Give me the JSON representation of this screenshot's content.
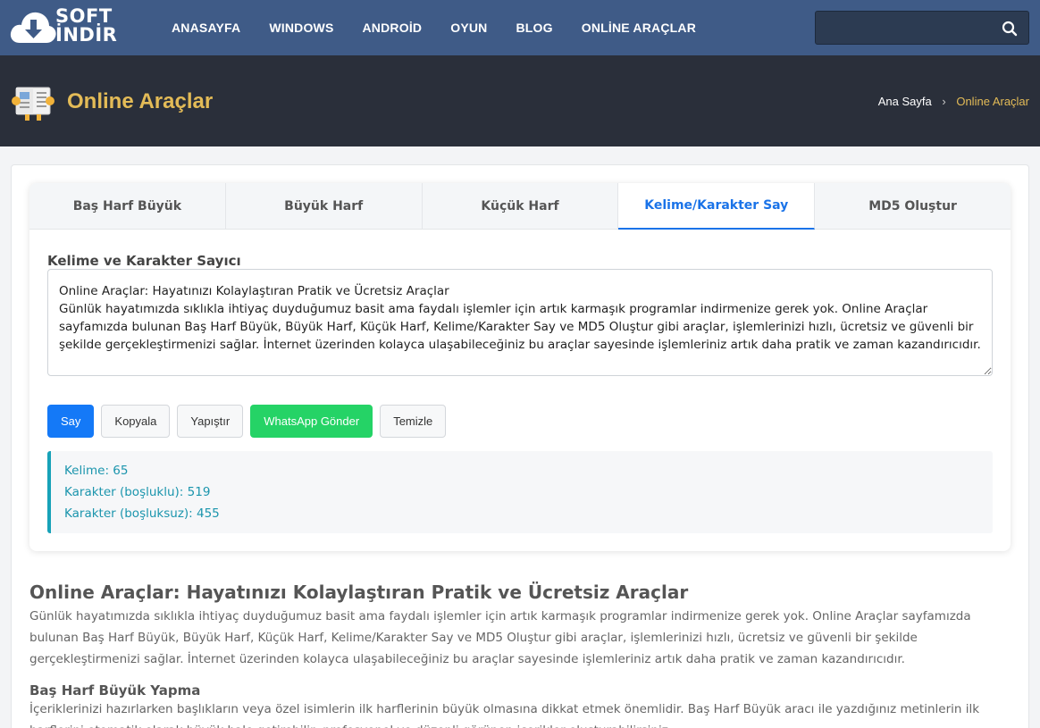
{
  "header": {
    "logo_line1": "SOFT",
    "logo_line2": "İNDİR",
    "nav": [
      "ANASAYFA",
      "WINDOWS",
      "ANDROİD",
      "OYUN",
      "BLOG",
      "ONLİNE ARAÇLAR"
    ],
    "search_placeholder": ""
  },
  "page": {
    "title": "Online Araçlar",
    "breadcrumb": {
      "home": "Ana Sayfa",
      "separator": "›",
      "current": "Online Araçlar"
    }
  },
  "tool": {
    "tabs": [
      "Baş Harf Büyük",
      "Büyük Harf",
      "Küçük Harf",
      "Kelime/Karakter Say",
      "MD5 Oluştur"
    ],
    "active_tab": "Kelime/Karakter Say",
    "label": "Kelime ve Karakter Sayıcı",
    "textarea_value": "Online Araçlar: Hayatınızı Kolaylaştıran Pratik ve Ücretsiz Araçlar\nGünlük hayatımızda sıklıkla ihtiyaç duyduğumuz basit ama faydalı işlemler için artık karmaşık programlar indirmenize gerek yok. Online Araçlar sayfamızda bulunan Baş Harf Büyük, Büyük Harf, Küçük Harf, Kelime/Karakter Say ve MD5 Oluştur gibi araçlar, işlemlerinizi hızlı, ücretsiz ve güvenli bir şekilde gerçekleştirmenizi sağlar. İnternet üzerinden kolayca ulaşabileceğiniz bu araçlar sayesinde işlemleriniz artık daha pratik ve zaman kazandırıcıdır.",
    "buttons": {
      "say": "Say",
      "kopyala": "Kopyala",
      "yapistir": "Yapıştır",
      "whatsapp": "WhatsApp Gönder",
      "temizle": "Temizle"
    },
    "result": {
      "kelime": "Kelime: 65",
      "karakter_bosluklu": "Karakter (boşluklu): 519",
      "karakter_bosluksuz": "Karakter (boşluksuz): 455"
    }
  },
  "article": {
    "heading": "Online Araçlar: Hayatınızı Kolaylaştıran Pratik ve Ücretsiz Araçlar",
    "intro": "Günlük hayatımızda sıklıkla ihtiyaç duyduğumuz basit ama faydalı işlemler için artık karmaşık programlar indirmenize gerek yok. Online Araçlar sayfamızda bulunan Baş Harf Büyük, Büyük Harf, Küçük Harf, Kelime/Karakter Say ve MD5 Oluştur gibi araçlar, işlemlerinizi hızlı, ücretsiz ve güvenli bir şekilde gerçekleştirmenizi sağlar. İnternet üzerinden kolayca ulaşabileceğiniz bu araçlar sayesinde işlemleriniz artık daha pratik ve zaman kazandırıcıdır.",
    "section1_heading": "Baş Harf Büyük Yapma",
    "section1_text": "İçeriklerinizi hazırlarken başlıkların veya özel isimlerin ilk harflerinin büyük olmasına dikkat etmek önemlidir. Baş Harf Büyük aracı ile yazdığınız metinlerin ilk harflerini otomatik olarak büyük hale getirebilir, profesyonel ve düzenli görünen içerikler oluşturabilirsiniz."
  },
  "colors": {
    "nav_bg": "#3f5b87",
    "header_bg": "#2a2f3a",
    "accent_gold": "#e3bb57",
    "active_tab": "#1a73e8",
    "primary_button": "#1479f7",
    "whatsapp_button": "#25d366",
    "result_text": "#1b95ad"
  }
}
